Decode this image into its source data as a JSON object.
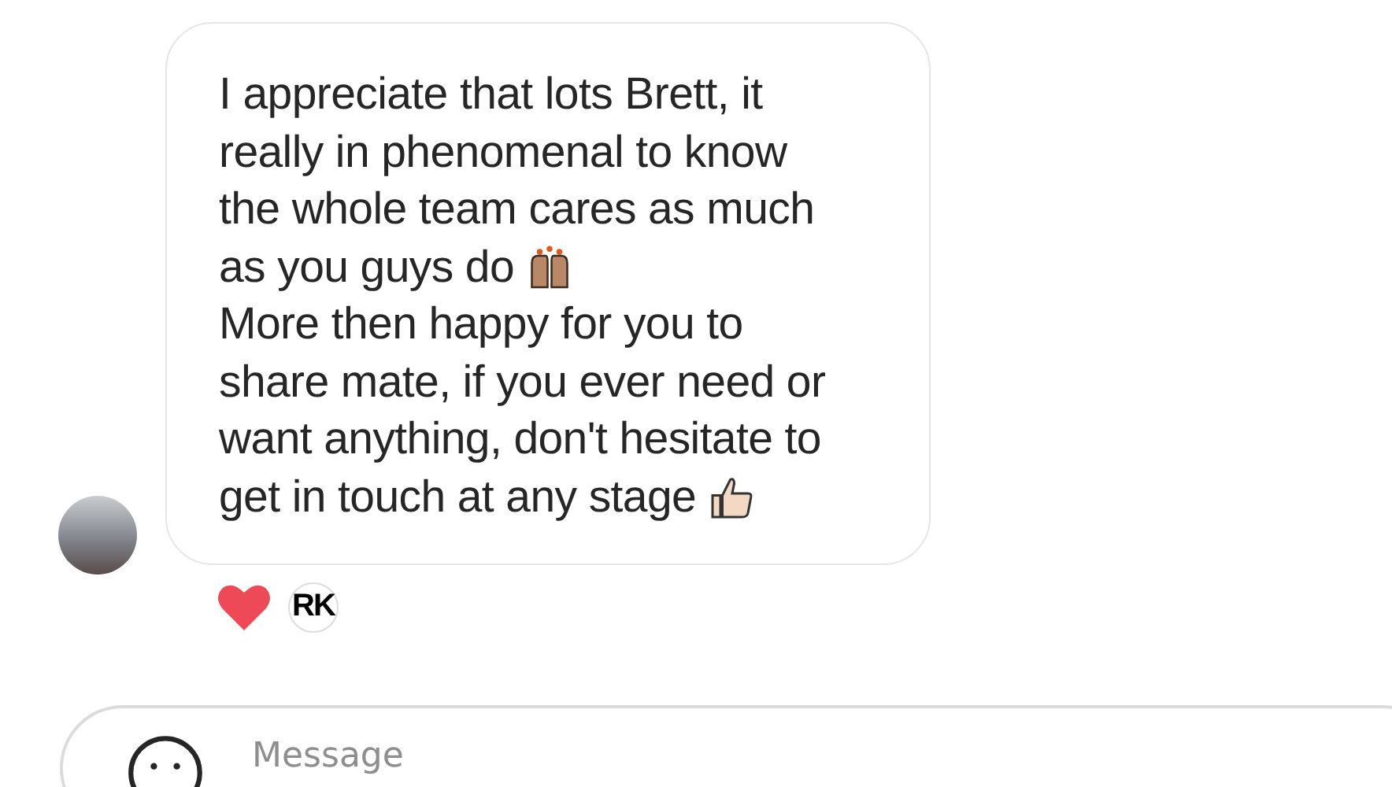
{
  "message": {
    "paragraphs": [
      {
        "text": "I appreciate that lots Brett, it really in phenomenal to know the whole team cares as much as you guys do",
        "kind": "raised-hands"
      },
      {
        "text": "More then happy for you to share mate, if you ever need or want anything, don't hesitate to get in touch at any stage",
        "kind": "thumbs-up"
      }
    ]
  },
  "reactions": [
    {
      "kind": "heart"
    },
    {
      "kind": "initials",
      "text": "RK"
    }
  ],
  "composer": {
    "placeholder": "Message"
  }
}
